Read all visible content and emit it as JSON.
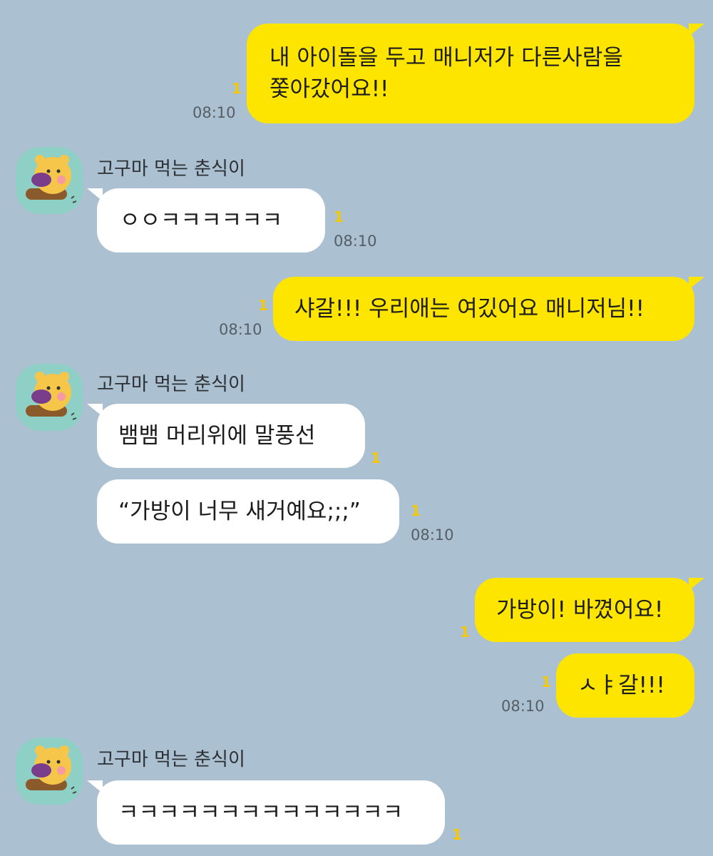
{
  "sender_name": "고구마 먹는 춘식이",
  "unread_mark": "1",
  "colors": {
    "background": "#abc1d1",
    "my_bubble": "#fee500",
    "other_bubble": "#ffffff",
    "unread": "#f5c800"
  },
  "messages": [
    {
      "side": "me",
      "lines": [
        "내 아이돌을 두고 매니저가 다른사람을",
        "쫓아갔어요!!"
      ],
      "unread": "1",
      "time": "08:10"
    },
    {
      "side": "other",
      "text": "ㅇㅇㅋㅋㅋㅋㅋㅋ",
      "unread": "1",
      "time": "08:10"
    },
    {
      "side": "me",
      "text": "샤갈!!! 우리애는 여깄어요 매니저님!!",
      "unread": "1",
      "time": "08:10"
    },
    {
      "side": "other",
      "text": "뱀뱀 머리위에 말풍선",
      "unread": "1"
    },
    {
      "side": "other",
      "text": "“가방이 너무 새거예요;;;”",
      "unread": "1",
      "time": "08:10"
    },
    {
      "side": "me",
      "text": "가방이! 바꼈어요!",
      "unread": "1"
    },
    {
      "side": "me",
      "text": "ㅅㅑ갈!!!",
      "unread": "1",
      "time": "08:10"
    },
    {
      "side": "other",
      "text": "ㅋㅋㅋㅋㅋㅋㅋㅋㅋㅋㅋㅋㅋㅋ",
      "unread": "1"
    }
  ]
}
